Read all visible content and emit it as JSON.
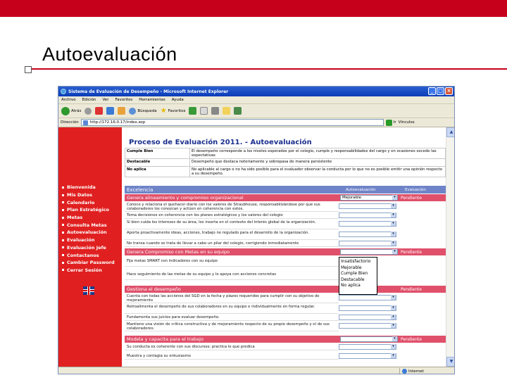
{
  "slide": {
    "title": "Autoevaluación",
    "accent": "#c6001a"
  },
  "browser": {
    "title": "Sistema de Evaluación de Desempeño - Microsoft Internet Explorer",
    "menu": [
      "Archivo",
      "Edición",
      "Ver",
      "Favoritos",
      "Herramientas",
      "Ayuda"
    ],
    "toolbar": {
      "back": "Atrás",
      "search": "Búsqueda",
      "favorites": "Favoritos"
    },
    "address_label": "Dirección",
    "address": "http://172.16.0.17/index.asp",
    "go": "Ir",
    "links": "Vínculos",
    "status": "Internet"
  },
  "nav": {
    "items": [
      "Bienvenida",
      "Mis Datos",
      "Calendario",
      "Plan Estratégico",
      "Metas",
      "Consulta Metas",
      "Autoevaluación",
      "Evaluación",
      "Evaluación Jefe",
      "Contactanos",
      "Cambiar Password",
      "Cerrar Sesión"
    ]
  },
  "page": {
    "heading": "Proceso de Evaluación 2011. -  Autoevaluación",
    "legend": [
      {
        "key": "Cumple Bien",
        "desc": "El desempeño corresponde a los niveles esperados por el colegio, cumple y responsabilidades del cargo y en ocasiones excede las expectativas"
      },
      {
        "key": "Destacable",
        "desc": "Desempeño que destaca notoriamente y sobrepasa de manera persistente"
      },
      {
        "key": "No aplica",
        "desc": "No aplicable al cargo o no ha sido posible para el evaluador observar la conducta por lo que no es posible emitir una opinión respecto a su desempeño."
      }
    ],
    "header": {
      "section": "Excelencia",
      "col_self": "Autoevaluación",
      "col_eval": "Evaluación"
    },
    "status_label": "Pendiente",
    "groups": [
      {
        "title": "Genera alineamiento y compromiso organizacional",
        "selected": "Mejorable",
        "rows": [
          "Conoce y relaciona el quehacer diario con los valores de Straubhouse, responsabilizándose por que sus colaboradores los conozcan y actúen en coherencia con estos.",
          "Toma decisiones en coherencia con los planes estratégicos y los valores del colegio",
          "Si bien cuida los intereses de su área, los inserta en el contexto del interés global de la organización.",
          "Aporta proactivamente ideas, acciones, trabajo no regulado para el desarrollo de la organización.",
          "No transa cuando se trata de llevar a cabo un pilar del colegio, corrigiendo inmediatamente"
        ]
      },
      {
        "title": "Genera Compromiso con Metas en su equipo",
        "selected": "",
        "rows": [
          "Fija metas SMART con indicadores con su equipo",
          "Hace seguimiento de las metas de su equipo y lo apoya con acciones concretas"
        ]
      },
      {
        "title": "Gestiona el desempeño",
        "selected": "",
        "rows": [
          "Cuenta con todas las acciones del SGD en la fecha y plazos requeridos para cumplir con su objetivo de mejoramiento",
          "Retroalimenta el desempeño de sus colaboradores en su equipo e individualmente en forma regular.",
          "Fundamenta sus juicios para evaluar desempeño.",
          "Mantiene una visión de crítica constructiva y de mejoramiento respecto de su propio desempeño y el de sus colaboradores."
        ]
      },
      {
        "title": "Modela y capacita para el trabajo",
        "selected": "",
        "rows": [
          "Su conducta es coherente con sus discursos; practica lo que predica",
          "Muestra y contagia su entusiasmo"
        ]
      }
    ],
    "dropdown_options": [
      "Insatisfactorio",
      "Mejorable",
      "Cumple Bien",
      "Destacable",
      "No aplica"
    ]
  }
}
